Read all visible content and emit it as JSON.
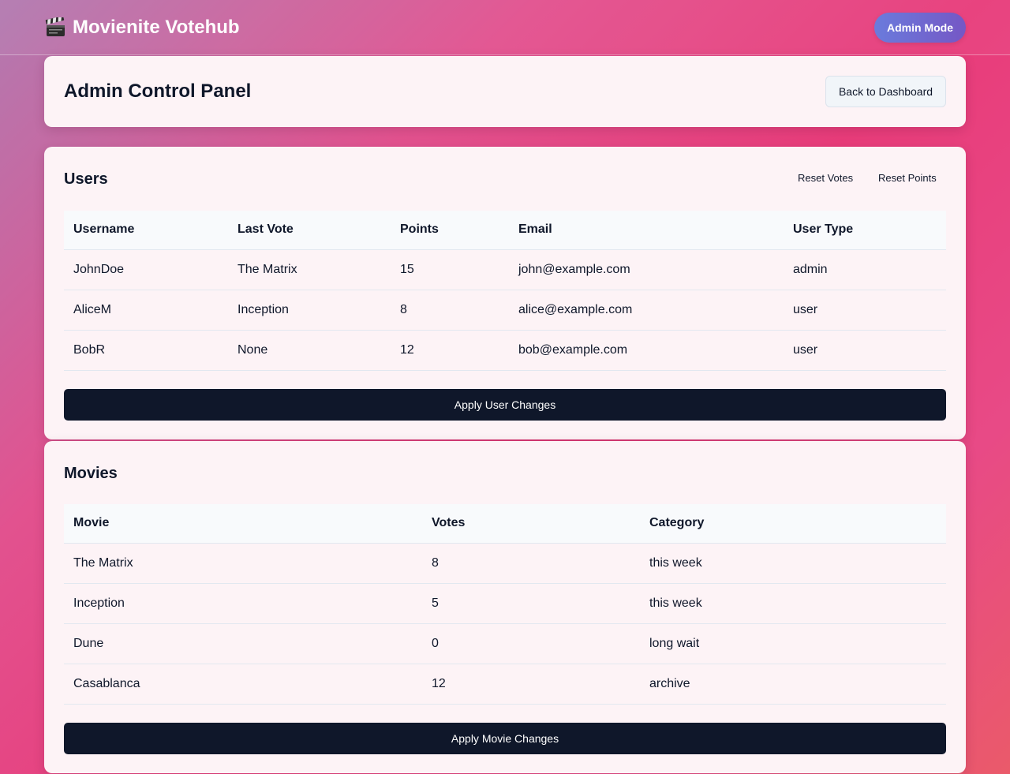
{
  "app": {
    "title": "Movienite Votehub",
    "icon": "clapper-board-icon",
    "mode_label": "Admin Mode"
  },
  "header": {
    "title": "Admin Control Panel",
    "back_label": "Back to Dashboard"
  },
  "users": {
    "title": "Users",
    "reset_votes_label": "Reset Votes",
    "reset_points_label": "Reset Points",
    "columns": [
      "Username",
      "Last Vote",
      "Points",
      "Email",
      "User Type"
    ],
    "rows": [
      [
        "JohnDoe",
        "The Matrix",
        "15",
        "john@example.com",
        "admin"
      ],
      [
        "AliceM",
        "Inception",
        "8",
        "alice@example.com",
        "user"
      ],
      [
        "BobR",
        "None",
        "12",
        "bob@example.com",
        "user"
      ]
    ],
    "apply_label": "Apply User Changes"
  },
  "movies": {
    "title": "Movies",
    "columns": [
      "Movie",
      "Votes",
      "Category"
    ],
    "rows": [
      [
        "The Matrix",
        "8",
        "this week"
      ],
      [
        "Inception",
        "5",
        "this week"
      ],
      [
        "Dune",
        "0",
        "long wait"
      ],
      [
        "Casablanca",
        "12",
        "archive"
      ]
    ],
    "apply_label": "Apply Movie Changes"
  },
  "colors": {
    "primary_button": "#0f172a",
    "admin_badge_start": "#6a7bdc",
    "admin_badge_end": "#7557c5",
    "card_background": "#fdf3f6"
  }
}
